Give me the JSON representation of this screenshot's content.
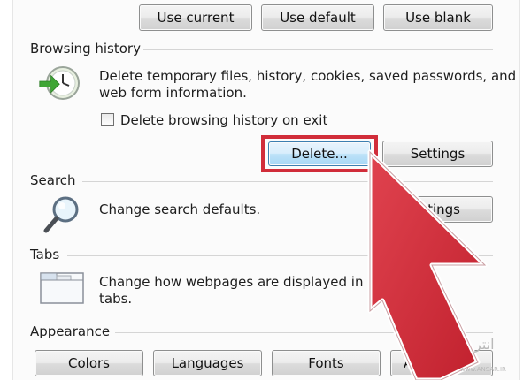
{
  "home_page": {
    "use_current_label": "Use current",
    "use_default_label": "Use default",
    "use_blank_label": "Use blank"
  },
  "browsing_history": {
    "section_title": "Browsing history",
    "icon": "clock-history-icon",
    "description_line1": "Delete temporary files, history, cookies, saved passwords, and",
    "description_line2": "web form information.",
    "checkbox_label": "Delete browsing history on exit",
    "checkbox_checked": false,
    "delete_label": "Delete...",
    "settings_label": "Settings"
  },
  "search": {
    "section_title": "Search",
    "icon": "magnifier-icon",
    "description": "Change search defaults.",
    "settings_label_visible": "ttings"
  },
  "tabs": {
    "section_title": "Tabs",
    "icon": "tabs-window-icon",
    "description_line1": "Change how webpages are displayed in",
    "description_line2": "tabs."
  },
  "appearance": {
    "section_title": "Appearance",
    "colors_label": "Colors",
    "languages_label": "Languages",
    "fonts_label": "Fonts",
    "accessibility_label_visible": "Access"
  },
  "overlay": {
    "arrow_color": "#d12d3a",
    "highlight_color": "#d12d3a",
    "arrow_icon": "red-pointer-arrow-icon"
  },
  "watermark": {
    "text": "انتر",
    "subtext": "www.ANSAR.IR"
  }
}
